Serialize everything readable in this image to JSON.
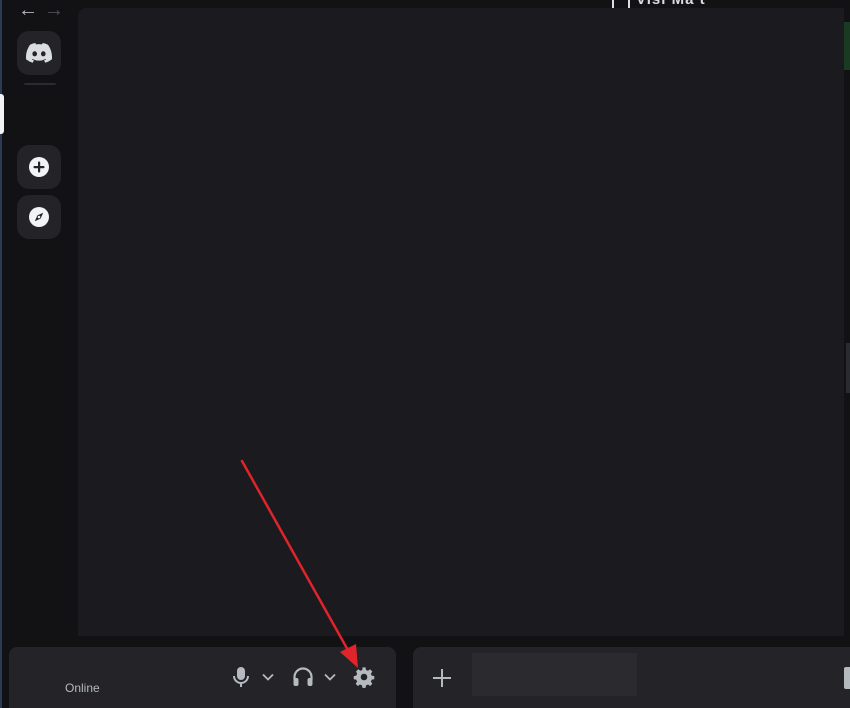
{
  "topbar": {
    "back_glyph": "←",
    "forward_glyph": "→",
    "title": "Visi   Ma  t"
  },
  "rail": {
    "items": [
      {
        "icon": "discord-logo-icon",
        "selected": true
      },
      {
        "icon": "plus-circle-icon",
        "action": "add-server"
      },
      {
        "icon": "compass-icon",
        "action": "discover"
      }
    ]
  },
  "user_panel": {
    "status": "Online",
    "controls": [
      "microphone-icon",
      "chevron-down-icon",
      "headphones-icon",
      "chevron-down-icon",
      "gear-icon"
    ]
  },
  "composer": {
    "plus_icon": "plus-icon",
    "input_value": "",
    "input_placeholder": ""
  },
  "annotation": {
    "arrow_color": "#e0242c",
    "target": "gear-icon"
  },
  "colors": {
    "background": "#121214",
    "panel": "#1b1b1f",
    "bar": "#232328",
    "icon": "#b5bac1",
    "text": "#dbdee1"
  }
}
